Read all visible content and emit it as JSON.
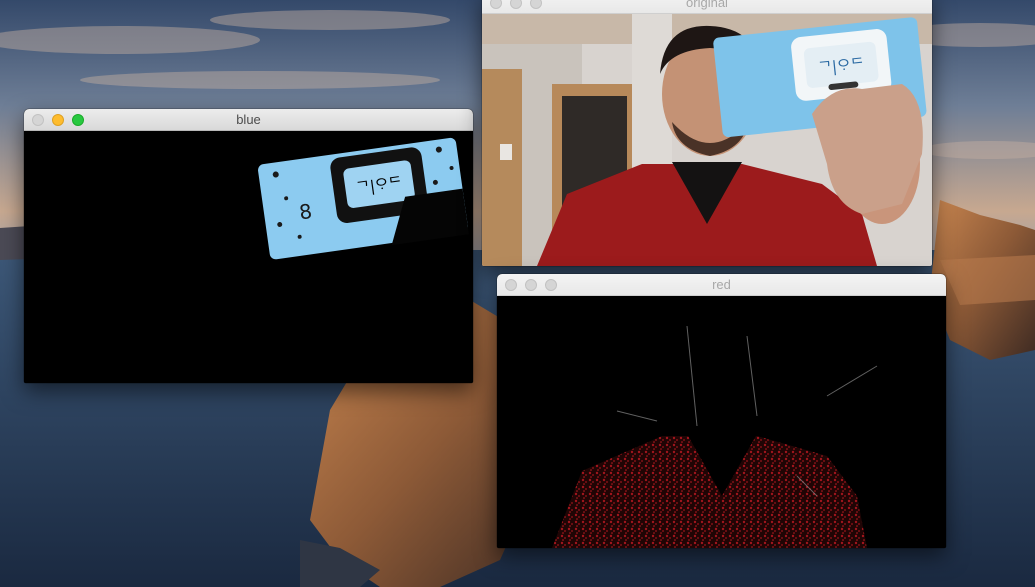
{
  "windows": {
    "blue": {
      "title": "blue",
      "state": "active",
      "image": "blue-mask-video-frame"
    },
    "original": {
      "title": "original",
      "state": "inactive",
      "image": "webcam-video-frame"
    },
    "red": {
      "title": "red",
      "state": "inactive",
      "image": "red-mask-video-frame"
    }
  },
  "package_text": "ᄀ|ᄋᆞᄃ"
}
